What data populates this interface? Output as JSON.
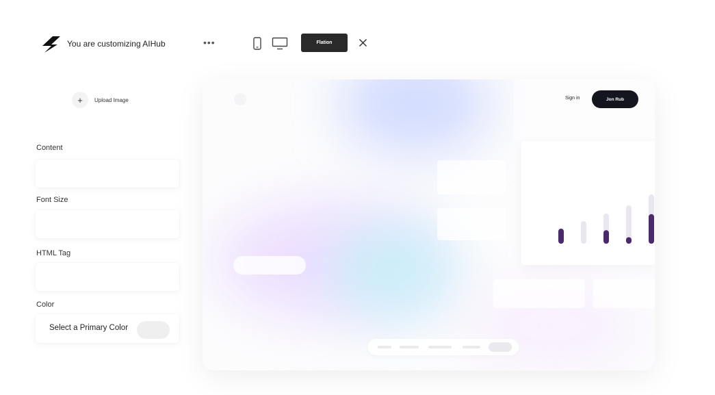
{
  "header": {
    "title": "You are customizing AIHub",
    "platform_button": "Flation",
    "icons": [
      "bolt-logo-icon",
      "more-icon",
      "mobile-icon",
      "desktop-icon",
      "close-icon"
    ]
  },
  "sidebar": {
    "upload_label": "Upload Image",
    "fields": [
      {
        "label": "Content",
        "value": ""
      },
      {
        "label": "Font Size",
        "value": ""
      },
      {
        "label": "HTML Tag",
        "value": ""
      }
    ],
    "color": {
      "label": "Color",
      "placeholder": "Select a Primary Color"
    }
  },
  "preview": {
    "signin_label": "Sign in",
    "join_label": "Jon Rub",
    "chart_bars": [
      {
        "track": 0,
        "fill": 1.0
      },
      {
        "track": 1.0,
        "fill": 0
      },
      {
        "track": 1.0,
        "fill": 0.45
      },
      {
        "track": 1.0,
        "fill": 0.17
      },
      {
        "track": 1.0,
        "fill": 0.6
      }
    ]
  },
  "colors": {
    "accent": "#4a2a6a",
    "button_dark": "#2a2a2a",
    "join_dark": "#151520"
  }
}
